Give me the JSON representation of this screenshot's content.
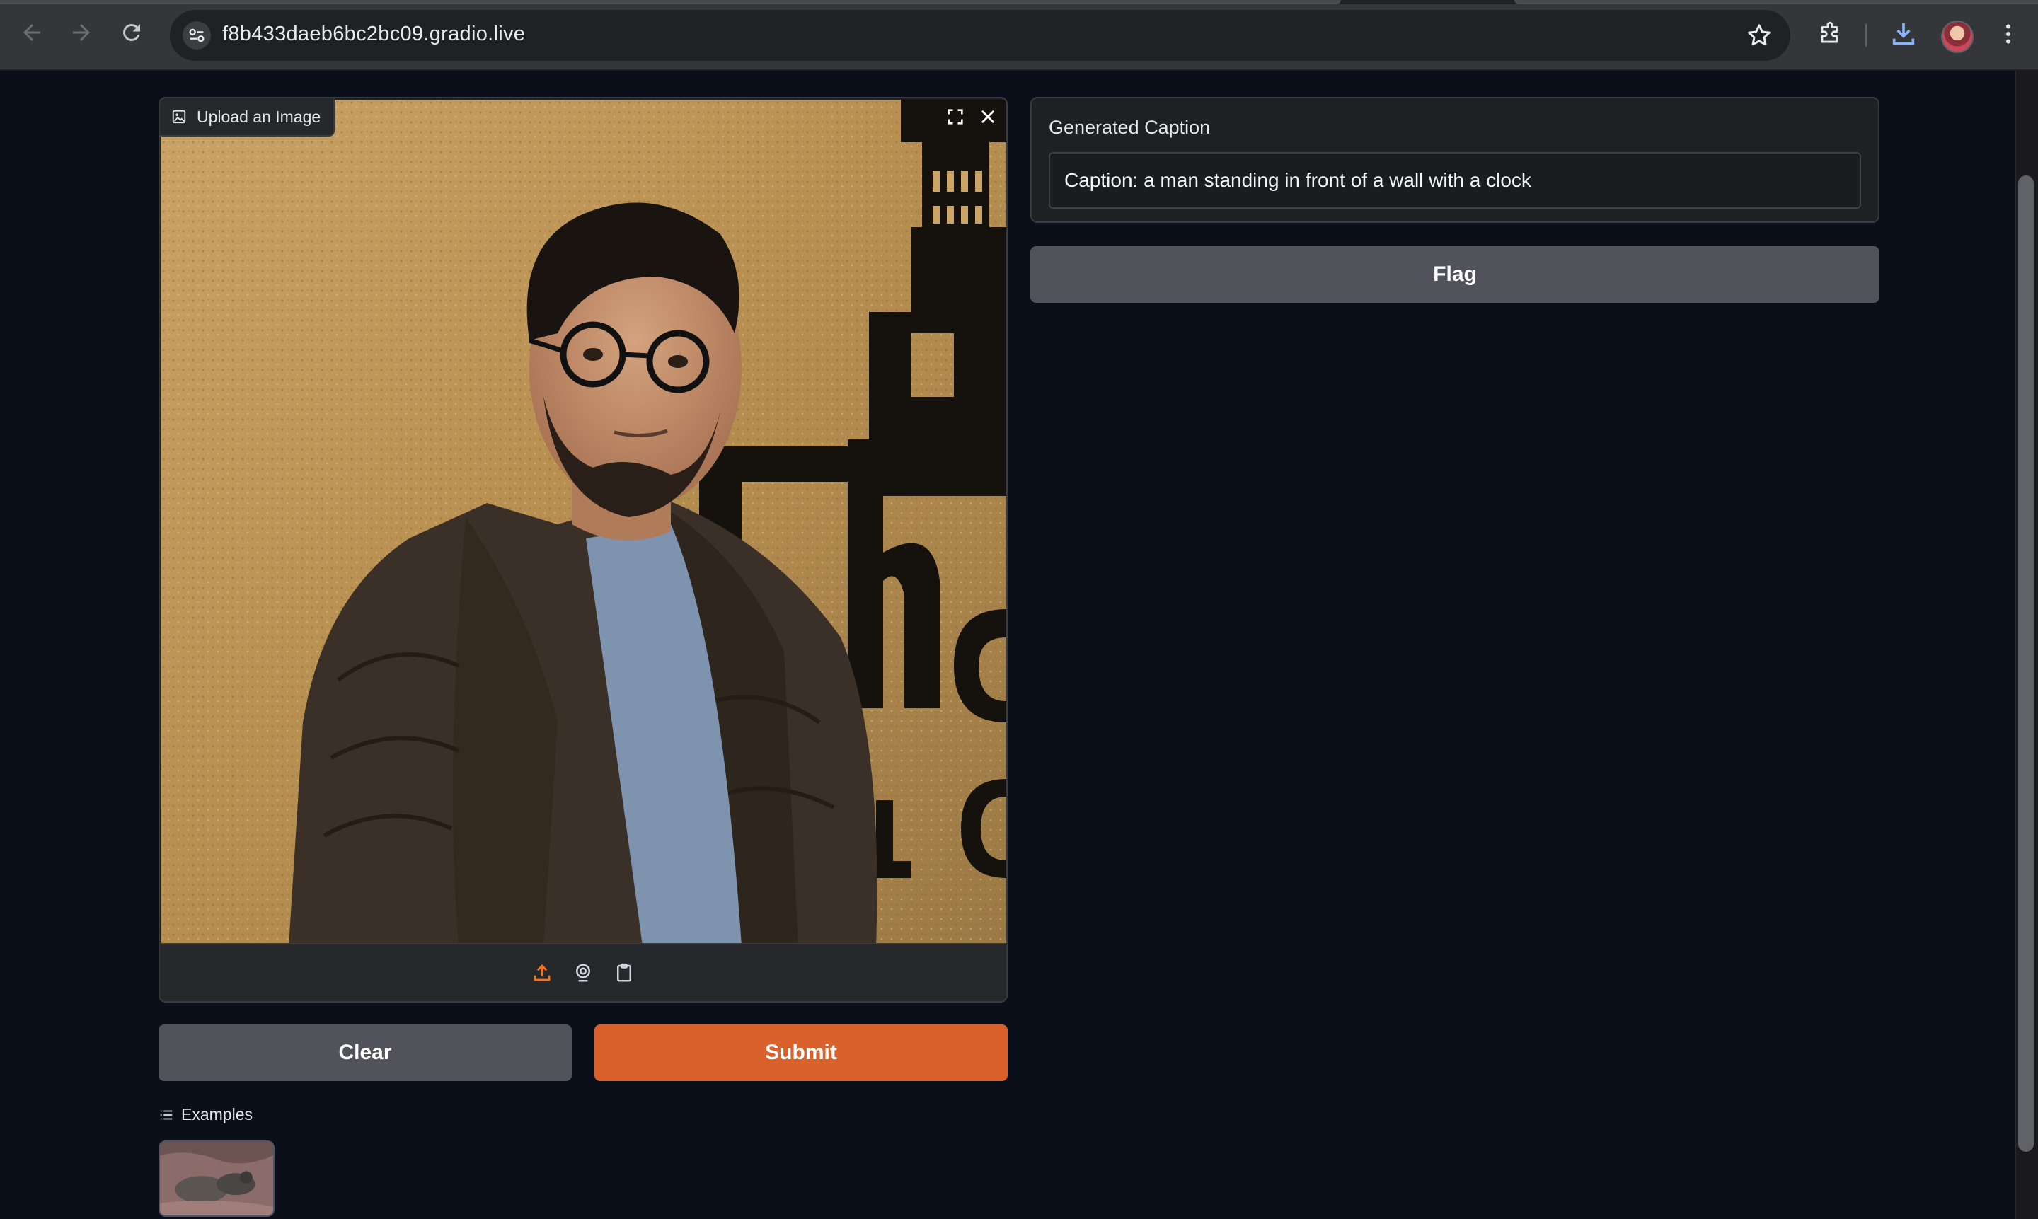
{
  "browser": {
    "url": "f8b433daeb6bc2bc09.gradio.live",
    "icons": [
      "back-arrow-icon",
      "forward-arrow-icon",
      "reload-icon",
      "site-info-icon",
      "bookmark-star-icon",
      "extensions-icon",
      "download-icon",
      "profile-avatar",
      "more-menu-icon"
    ]
  },
  "input": {
    "image_label": "Upload an Image",
    "toolbar_icons": [
      "upload-icon",
      "webcam-icon",
      "clipboard-icon"
    ],
    "corner_icons": [
      "fullscreen-icon",
      "close-icon"
    ]
  },
  "buttons": {
    "clear": "Clear",
    "submit": "Submit",
    "flag": "Flag"
  },
  "output": {
    "label": "Generated Caption",
    "caption": "Caption: a man standing in front of a wall with a clock"
  },
  "examples": {
    "label": "Examples"
  },
  "colors": {
    "page_bg": "#0b0f19",
    "panel_bg": "#1f2022",
    "secondary_button": "#52525b",
    "primary_button": "#d9612b",
    "accent_icon": "#f97316"
  }
}
